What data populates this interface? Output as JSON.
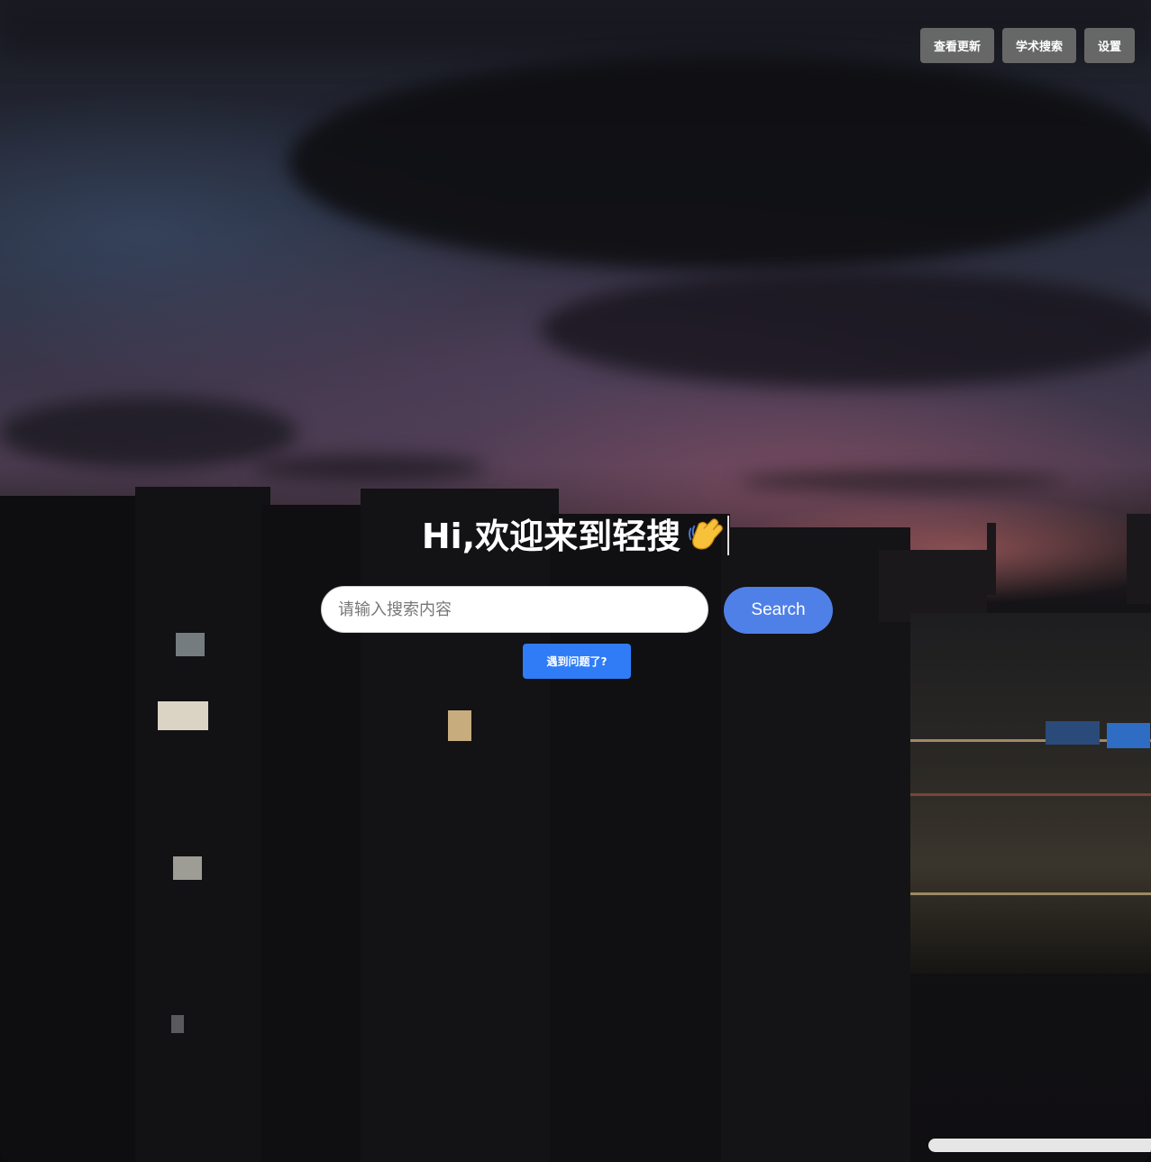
{
  "topbar": {
    "updates_label": "查看更新",
    "academic_label": "学术搜索",
    "settings_label": "设置"
  },
  "hero": {
    "greeting": "Hi,欢迎来到轻搜",
    "emoji_icon": "waving-hand-icon"
  },
  "search": {
    "placeholder": "请输入搜索内容",
    "value": "",
    "button_label": "Search"
  },
  "help": {
    "label": "遇到问题了?"
  },
  "colors": {
    "search_button": "#4f80e8",
    "help_button": "#2f7cf6",
    "top_button": "#6e6e6e"
  }
}
